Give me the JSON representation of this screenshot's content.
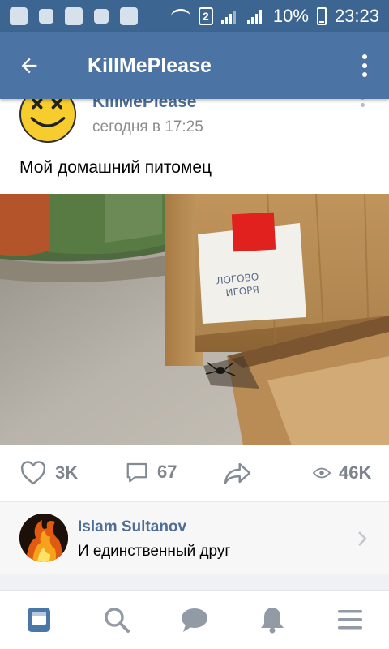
{
  "status_bar": {
    "battery": "10%",
    "time": "23:23",
    "sim": "2"
  },
  "app_bar": {
    "title": "KillMePlease"
  },
  "post": {
    "author": "KillMePlease",
    "time": "сегодня в 17:25",
    "text": "Мой домашний питомец",
    "photo_note_line1": "ЛОГОВО",
    "photo_note_line2": "ИГОРЯ",
    "likes": "3K",
    "comments": "67",
    "views": "46K"
  },
  "comment": {
    "author": "Islam Sultanov",
    "text": "И единственный друг"
  },
  "colors": {
    "status_bar": "#3d6591",
    "app_bar": "#4b73a3",
    "link": "#4d6e95",
    "nav_active": "#4a76a8",
    "nav_inactive": "#929ba5"
  },
  "icons": {
    "status_left": [
      "notification-icon",
      "app-icon",
      "alert-icon",
      "cleaner-icon",
      "image-icon"
    ],
    "nav": [
      "news-icon",
      "search-icon",
      "messages-icon",
      "notifications-icon",
      "menu-icon"
    ]
  }
}
